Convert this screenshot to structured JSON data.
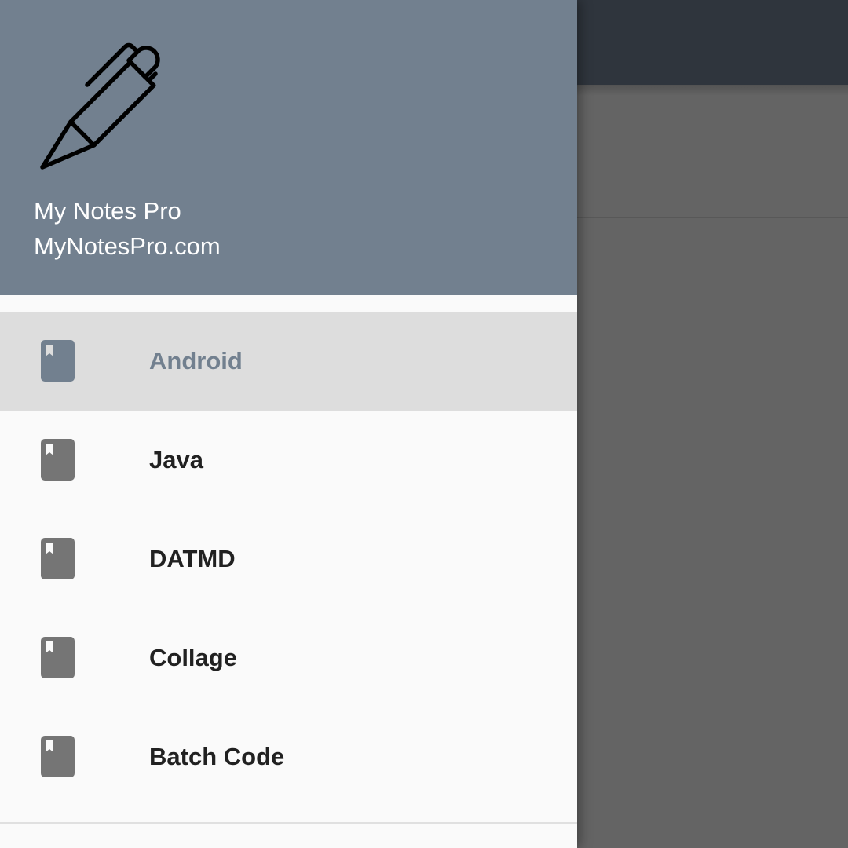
{
  "header": {
    "title": "My Notes Pro",
    "subtitle": "MyNotesPro.com",
    "logo_icon": "pen-icon",
    "background_color": "#72808f"
  },
  "menu": {
    "items": [
      {
        "label": "Android",
        "icon": "book-icon",
        "selected": true
      },
      {
        "label": "Java",
        "icon": "book-icon",
        "selected": false
      },
      {
        "label": "DATMD",
        "icon": "book-icon",
        "selected": false
      },
      {
        "label": "Collage",
        "icon": "book-icon",
        "selected": false
      },
      {
        "label": "Batch Code",
        "icon": "book-icon",
        "selected": false
      }
    ]
  },
  "colors": {
    "accent": "#72808f",
    "app_bar": "#2f353d",
    "scrim": "#646464",
    "icon_default": "#757575",
    "selected_row": "#dddddd"
  }
}
